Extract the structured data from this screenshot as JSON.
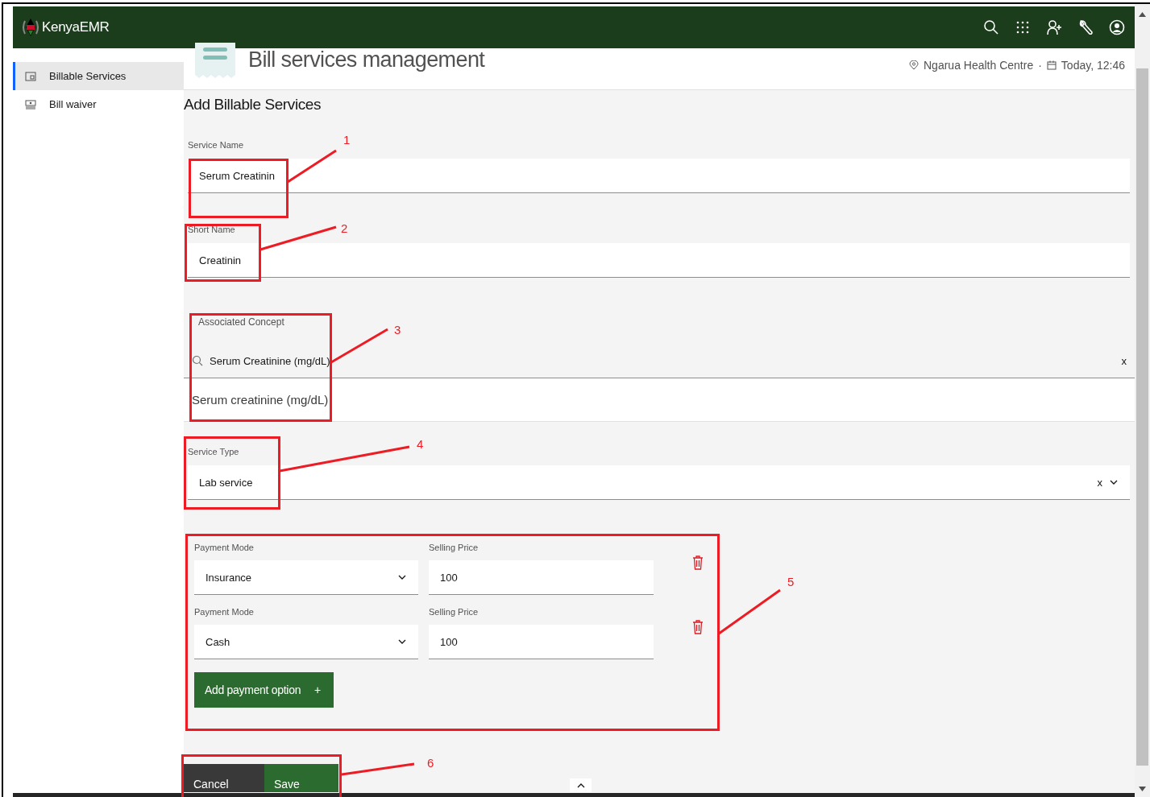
{
  "header": {
    "app_name": "KenyaEMR"
  },
  "sidebar": {
    "items": [
      {
        "label": "Billable Services",
        "selected": true
      },
      {
        "label": "Bill waiver",
        "selected": false
      }
    ]
  },
  "page_header": {
    "title": "Bill services management",
    "location": "Ngarua Health Centre",
    "separator": "·",
    "date": "Today, 12:46"
  },
  "form": {
    "heading": "Add Billable Services",
    "service_name": {
      "label": "Service Name",
      "value": "Serum Creatinin"
    },
    "short_name": {
      "label": "Short Name",
      "value": "Creatinin"
    },
    "associated_concept": {
      "label": "Associated Concept",
      "value": "Serum Creatinine (mg/dL)",
      "clear": "x",
      "results": [
        "Serum creatinine (mg/dL)"
      ]
    },
    "service_type": {
      "label": "Service Type",
      "value": "Lab service",
      "clear": "x"
    },
    "payment_options": [
      {
        "mode_label": "Payment Mode",
        "mode": "Insurance",
        "price_label": "Selling Price",
        "price": "100"
      },
      {
        "mode_label": "Payment Mode",
        "mode": "Cash",
        "price_label": "Selling Price",
        "price": "100"
      }
    ],
    "add_button": {
      "label": "Add payment option",
      "icon": "+"
    }
  },
  "actions": {
    "cancel": "Cancel",
    "save": "Save"
  },
  "annotations": [
    {
      "number": "1"
    },
    {
      "number": "2"
    },
    {
      "number": "3"
    },
    {
      "number": "4"
    },
    {
      "number": "5"
    },
    {
      "number": "6"
    }
  ]
}
